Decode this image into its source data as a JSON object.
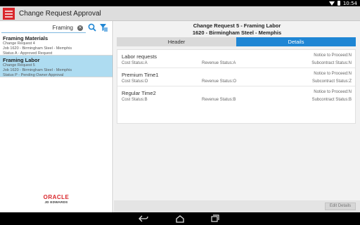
{
  "status_bar": {
    "time": "10:54"
  },
  "action_bar": {
    "title": "Change Request Approval"
  },
  "left_pane": {
    "search": {
      "value": "Framing"
    },
    "items": [
      {
        "title": "Framing Materials",
        "lines": [
          "Change Request 4",
          "Job 1620 - Birmingham Steel - Memphis",
          "Status A - Approved Request"
        ],
        "selected": false
      },
      {
        "title": "Framing Labor",
        "lines": [
          "Change Request 5",
          "Job 1620 - Birmingham Steel - Memphis",
          "Status P - Pending Owner Approval"
        ],
        "selected": true
      }
    ],
    "logo": {
      "oracle": "ORACLE",
      "jde": "JD EDWARDS"
    }
  },
  "right_pane": {
    "title_line1": "Change Request 5 - Framing Labor",
    "title_line2": "1620 - Birmingham Steel - Memphis",
    "tabs": [
      {
        "label": "Header",
        "active": false
      },
      {
        "label": "Details",
        "active": true
      }
    ],
    "details": [
      {
        "name": "Labor requests",
        "notice": "Notice to Proceed:N",
        "cost": "Cost Status:A",
        "revenue": "Revenue Status:A",
        "subcontract": "Subcontract Status:N"
      },
      {
        "name": "Premium Time1",
        "notice": "Notice to Proceed:N",
        "cost": "Cost Status:O",
        "revenue": "Revenue Status:O",
        "subcontract": "Subcontract Status:Z"
      },
      {
        "name": "Regular Time2",
        "notice": "Notice to Proceed:N",
        "cost": "Cost Status:B",
        "revenue": "Revenue Status:B",
        "subcontract": "Subcontract Status:B"
      }
    ],
    "edit_button": "Edit Details"
  },
  "colors": {
    "accent": "#1f86d4",
    "selected": "#aedcf1",
    "brand_red": "#d9262b"
  }
}
